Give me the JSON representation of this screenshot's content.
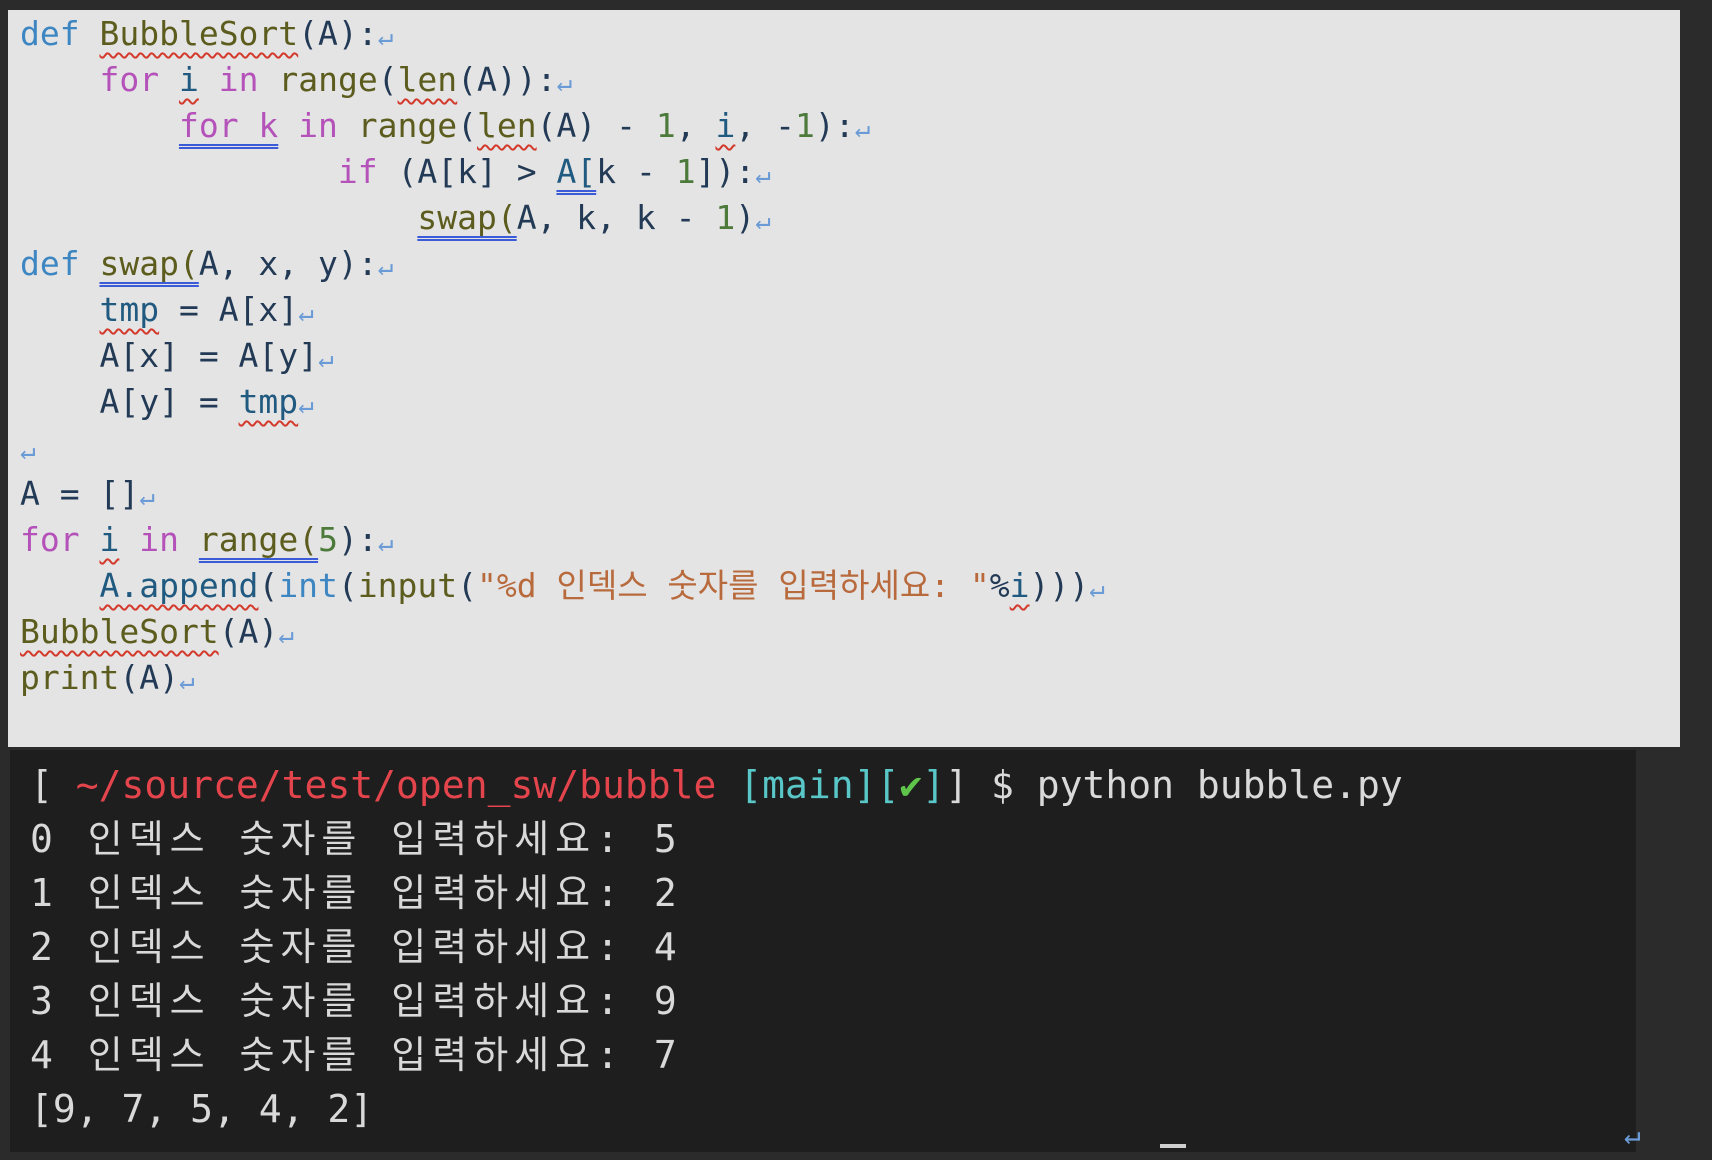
{
  "editor": {
    "return_mark": "↵",
    "lines": [
      [
        "def",
        " ",
        "BubbleSort",
        "(A):"
      ],
      [
        "    ",
        "for",
        " ",
        "i",
        " ",
        "in",
        " ",
        "range",
        "(",
        "len",
        "(A)):"
      ],
      [
        "        ",
        "for k",
        " ",
        "in",
        " ",
        "range",
        "(",
        "len",
        "(A) - ",
        "1",
        ", ",
        "i",
        ", -",
        "1",
        "):"
      ],
      [
        "                ",
        "if",
        " (A[k] > ",
        "A[",
        "k - ",
        "1",
        "]):"
      ],
      [
        "                    ",
        "swap(",
        "A, k, k - ",
        "1",
        ")"
      ],
      [
        "def",
        " ",
        "swap(",
        "A, x, y):"
      ],
      [
        "    ",
        "tmp",
        " = A[x]"
      ],
      [
        "    ",
        "A[x] = A[y]"
      ],
      [
        "    ",
        "A[y] = ",
        "tmp"
      ],
      [],
      [
        "A = []"
      ],
      [
        "for",
        " ",
        "i",
        " ",
        "in",
        " ",
        "range(",
        "5",
        "):"
      ],
      [
        "    ",
        "A.append",
        "(",
        "int",
        "(",
        "input",
        "(",
        "\"%d 인덱스 숫자를 입력하세요: \"",
        "%",
        "i",
        ")))"
      ],
      [
        "BubbleSort",
        "(A)"
      ],
      [
        "print",
        "(A)"
      ]
    ]
  },
  "terminal": {
    "prompt_open": "[ ",
    "path": "~/source/test/open_sw/bubble",
    "branch": " [main]",
    "status_open": "[",
    "status_check": "✔",
    "status_close": "]",
    "prompt_close": "] $ ",
    "command": "python bubble.py",
    "output_lines": [
      "0 인덱스 숫자를 입력하세요: 5",
      "1 인덱스 숫자를 입력하세요: 2",
      "2 인덱스 숫자를 입력하세요: 4",
      "3 인덱스 숫자를 입력하세요: 9",
      "4 인덱스 숫자를 입력하세요: 7",
      "[9, 7, 5, 4, 2]"
    ],
    "return_mark": "↵"
  }
}
